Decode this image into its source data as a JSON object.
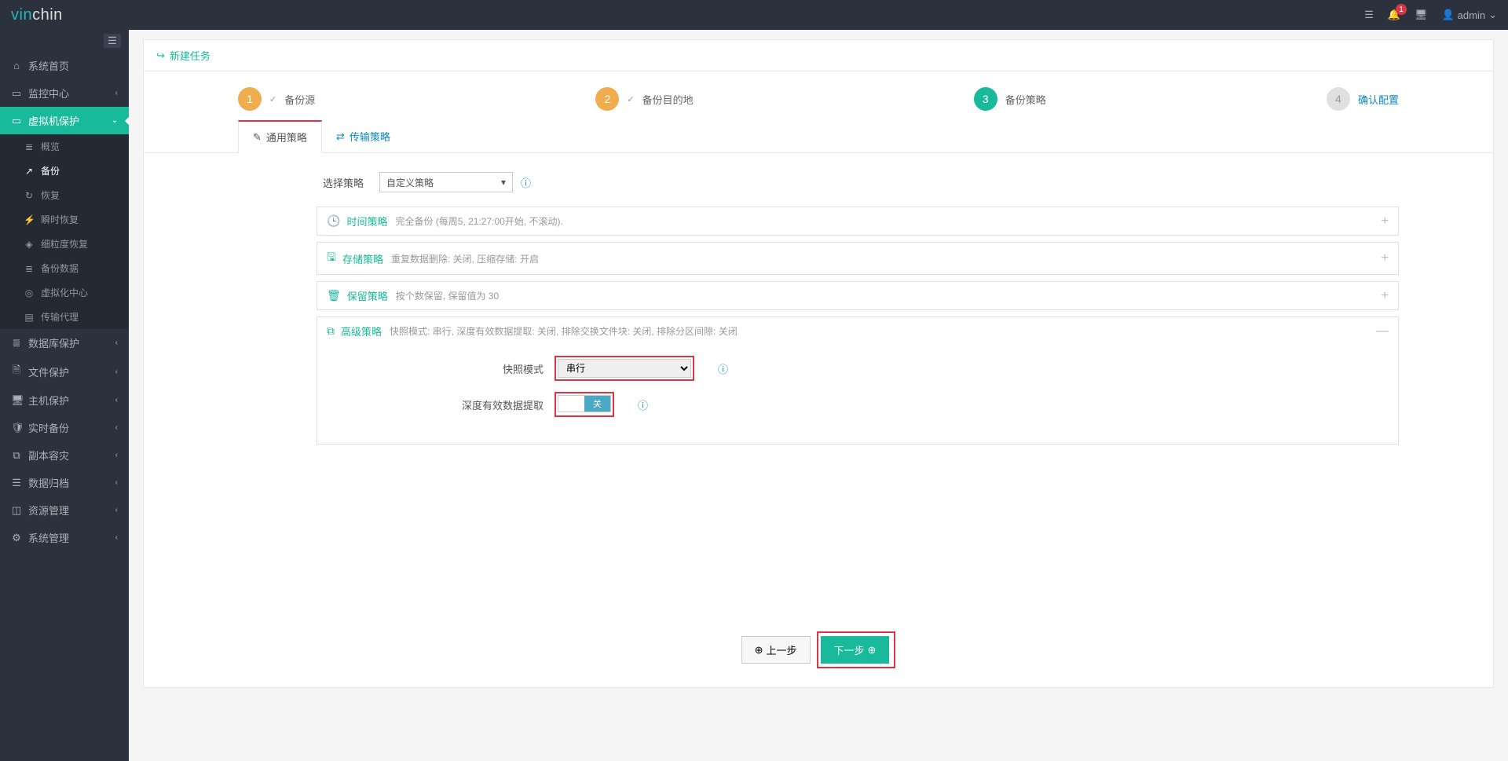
{
  "topbar": {
    "logo_vin": "vin",
    "logo_chin": "chin",
    "notif_count": "1",
    "user": "admin"
  },
  "sidebar": {
    "items": [
      {
        "icon": "⌂",
        "label": "系统首页"
      },
      {
        "icon": "▭",
        "label": "监控中心",
        "expand": "‹"
      },
      {
        "icon": "▭",
        "label": "虚拟机保护",
        "expand": "⌄",
        "active": true
      },
      {
        "icon": "≣",
        "label": "数据库保护",
        "expand": "‹"
      },
      {
        "icon": "🗎",
        "label": "文件保护",
        "expand": "‹"
      },
      {
        "icon": "🖥",
        "label": "主机保护",
        "expand": "‹"
      },
      {
        "icon": "🛡",
        "label": "实时备份",
        "expand": "‹"
      },
      {
        "icon": "⧉",
        "label": "副本容灾",
        "expand": "‹"
      },
      {
        "icon": "☰",
        "label": "数据归档",
        "expand": "‹"
      },
      {
        "icon": "◫",
        "label": "资源管理",
        "expand": "‹"
      },
      {
        "icon": "⚙",
        "label": "系统管理",
        "expand": "‹"
      }
    ],
    "subitems": [
      {
        "icon": "≣",
        "label": "概览"
      },
      {
        "icon": "↗",
        "label": "备份",
        "current": true
      },
      {
        "icon": "↻",
        "label": "恢复"
      },
      {
        "icon": "⚡",
        "label": "瞬时恢复"
      },
      {
        "icon": "◈",
        "label": "细粒度恢复"
      },
      {
        "icon": "≣",
        "label": "备份数据"
      },
      {
        "icon": "◎",
        "label": "虚拟化中心"
      },
      {
        "icon": "▤",
        "label": "传输代理"
      }
    ]
  },
  "page": {
    "title": "新建任务"
  },
  "wizard": {
    "steps": [
      {
        "num": "1",
        "label": "备份源",
        "check": "✓",
        "cls": "done"
      },
      {
        "num": "2",
        "label": "备份目的地",
        "check": "✓",
        "cls": "done"
      },
      {
        "num": "3",
        "label": "备份策略",
        "check": "",
        "cls": "active"
      },
      {
        "num": "4",
        "label": "确认配置",
        "check": "",
        "cls": "pending"
      }
    ]
  },
  "tabs": {
    "general": "通用策略",
    "transport": "传输策略"
  },
  "form": {
    "select_strategy_label": "选择策略",
    "select_strategy_value": "自定义策略"
  },
  "accordion": [
    {
      "icon": "🕒",
      "title": "时间策略",
      "desc": "完全备份 (每周5, 21:27:00开始, 不滚动).",
      "toggle": "+"
    },
    {
      "icon": "🖫",
      "title": "存储策略",
      "desc": "重复数据删除: 关闭, 压缩存储: 开启",
      "toggle": "+"
    },
    {
      "icon": "🗑",
      "title": "保留策略",
      "desc": "按个数保留, 保留值为 30",
      "toggle": "+"
    },
    {
      "icon": "⧉",
      "title": "高级策略",
      "desc": "快照模式: 串行, 深度有效数据提取: 关闭, 排除交换文件块: 关闭, 排除分区间隙: 关闭",
      "toggle": "—"
    }
  ],
  "advanced": {
    "snapshot_label": "快照模式",
    "snapshot_value": "串行",
    "deep_label": "深度有效数据提取",
    "deep_toggle_on": "",
    "deep_toggle_off": "关"
  },
  "footer": {
    "prev": "上一步",
    "next": "下一步"
  }
}
